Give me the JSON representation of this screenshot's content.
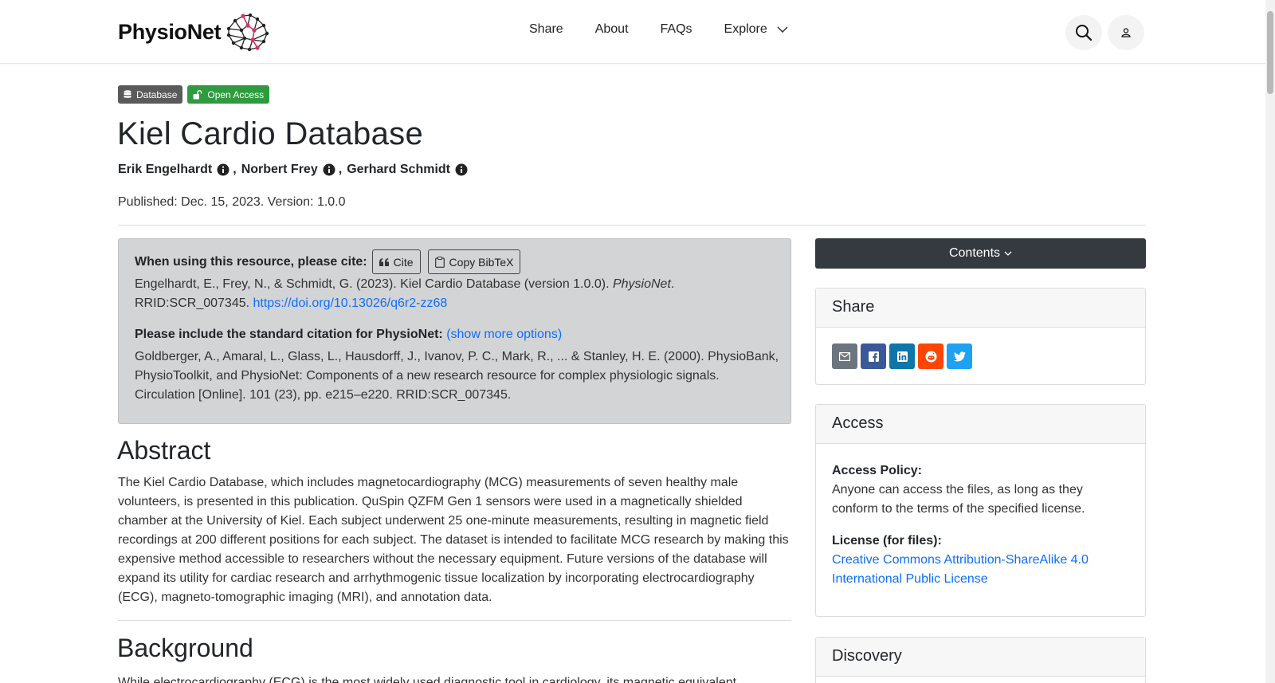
{
  "header": {
    "brand": "PhysioNet",
    "nav": [
      "Share",
      "About",
      "FAQs",
      "Explore"
    ]
  },
  "badges": {
    "database": "Database",
    "open_access": "Open Access"
  },
  "project": {
    "title": "Kiel Cardio Database",
    "authors": [
      "Erik Engelhardt",
      "Norbert Frey",
      "Gerhard Schmidt"
    ],
    "published": "Published: Dec. 15, 2023. Version: 1.0.0"
  },
  "citation": {
    "heading": "When using this resource, please cite:",
    "cite_button": "Cite",
    "bibtex_button": "Copy BibTeX",
    "text_pre": "Engelhardt, E., Frey, N., & Schmidt, G. (2023). Kiel Cardio Database (version 1.0.0). ",
    "text_italic": "PhysioNet",
    "text_post": ". RRID:SCR_007345. ",
    "doi": "https://doi.org/10.13026/q6r2-zz68",
    "standard_heading": "Please include the standard citation for PhysioNet:",
    "show_more": "(show more options)",
    "standard_text": "Goldberger, A., Amaral, L., Glass, L., Hausdorff, J., Ivanov, P. C., Mark, R., ... & Stanley, H. E. (2000). PhysioBank, PhysioToolkit, and PhysioNet: Components of a new research resource for complex physiologic signals. Circulation [Online]. 101 (23), pp. e215–e220. RRID:SCR_007345."
  },
  "abstract": {
    "heading": "Abstract",
    "text": "The Kiel Cardio Database, which includes magnetocardiography (MCG) measurements of seven healthy male volunteers, is presented in this publication. QuSpin QZFM Gen 1 sensors were used in a magnetically shielded chamber at the University of Kiel. Each subject underwent 25 one-minute measurements, resulting in magnetic field recordings at 200 different positions for each subject. The dataset is intended to facilitate MCG research by making this expensive method accessible to researchers without the necessary equipment. Future versions of the database will expand its utility for cardiac research and arrhythmogenic tissue localization by incorporating electrocardiography (ECG), magneto-tomographic imaging (MRI), and annotation data."
  },
  "background": {
    "heading": "Background",
    "text": "While electrocardiography (ECG) is the most widely used diagnostic tool in cardiology, its magnetic equivalent"
  },
  "sidebar": {
    "contents": "Contents",
    "share_heading": "Share",
    "access_heading": "Access",
    "access_policy_label": "Access Policy:",
    "access_policy_text": "Anyone can access the files, as long as they conform to the terms of the specified license.",
    "license_label": "License (for files):",
    "license_link": "Creative Commons Attribution-ShareAlike 4.0 International Public License",
    "discovery_heading": "Discovery"
  },
  "colors": {
    "email": "#6c757d",
    "facebook": "#3b5998",
    "linkedin": "#0e76a8",
    "reddit": "#ff4500",
    "twitter": "#1da1f2"
  }
}
